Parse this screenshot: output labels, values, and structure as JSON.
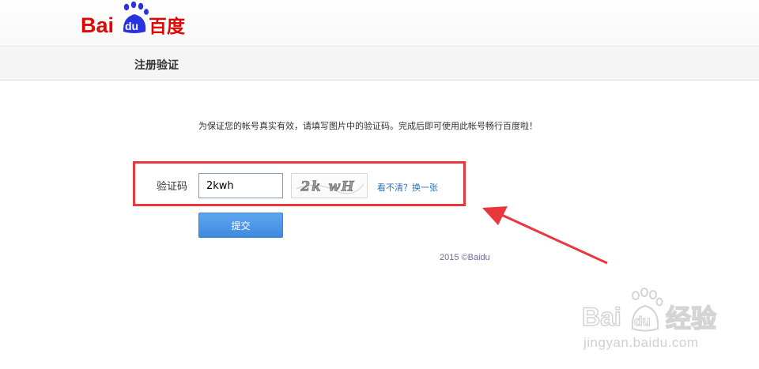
{
  "header": {
    "logo_text_bai": "Bai",
    "logo_text_du": "du",
    "logo_text_cn": "百度"
  },
  "subheader": {
    "title": "注册验证"
  },
  "main": {
    "notice": "为保证您的帐号真实有效，请填写图片中的验证码。完成后即可使用此帐号畅行百度啦！",
    "captcha_label": "验证码",
    "captcha_value": "2kwh",
    "captcha_image_text": "2k wH",
    "refresh_link": "看不清？换一张",
    "submit_label": "提交"
  },
  "footer": {
    "copyright": "2015 ©Baidu"
  },
  "watermark": {
    "brand_bai": "Bai",
    "brand_du": "du",
    "brand_cn": "经验",
    "url": "jingyan.baidu.com"
  },
  "colors": {
    "brand_red": "#e10602",
    "brand_blue": "#2932e1",
    "highlight_red": "#e8383d",
    "link_blue": "#2b6fbd"
  }
}
